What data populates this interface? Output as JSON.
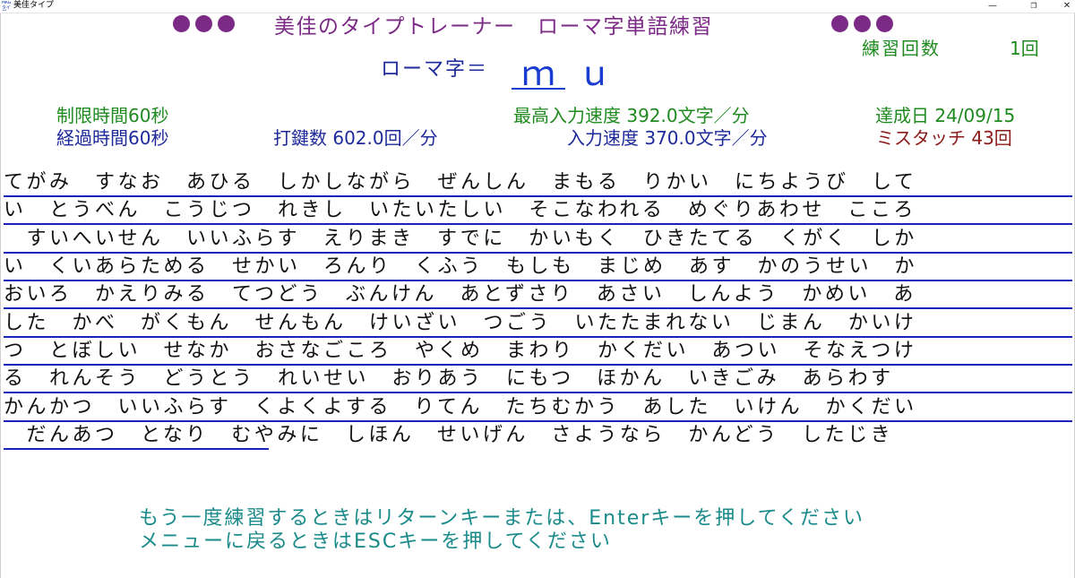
{
  "window": {
    "icon_text": "MKG タイプ",
    "title": "美佳タイプ",
    "min": "—",
    "max": "❐",
    "close": "✕"
  },
  "header": {
    "title": "美佳のタイプトレーナー　ローマ字単語練習"
  },
  "practice_count": {
    "label": "練習回数",
    "value": "1回"
  },
  "romaji": {
    "label": "ローマ字＝",
    "typed": "ｍ",
    "rest": "ｕ"
  },
  "stats": {
    "time_limit": "制限時間60秒",
    "elapsed": "経過時間60秒",
    "keystrokes": "打鍵数 602.0回／分",
    "best_speed": "最高入力速度 392.0文字／分",
    "achieved_date": "達成日 24/09/15",
    "input_speed": "入力速度 370.0文字／分",
    "mistouch": "ミスタッチ 43回"
  },
  "text_lines": [
    "てがみ　すなお　あひる　しかしながら　ぜんしん　まもる　りかい　にちようび　して",
    "い　とうべん　こうじつ　れきし　いたいたしい　そこなわれる　めぐりあわせ　こころ",
    "　すいへいせん　いいふらす　えりまき　すでに　かいもく　ひきたてる　くがく　しか",
    "い　くいあらためる　せかい　ろんり　くふう　もしも　まじめ　あす　かのうせい　か",
    "おいろ　かえりみる　てつどう　ぶんけん　あとずさり　あさい　しんよう　かめい　あ",
    "した　かべ　がくもん　せんもん　けいざい　つごう　いたたまれない　じまん　かいけ",
    "つ　とぼしい　せなか　おさなごころ　やくめ　まわり　かくだい　あつい　そなえつけ",
    "る　れんそう　どうとう　れいせい　おりあう　にもつ　ほかん　いきごみ　あらわす",
    "かんかつ　いいふらす　くよくよする　りてん　たちむかう　あした　いけん　かくだい",
    "　だんあつ　となり　むやみに　しほん　せいげん　さようなら　かんどう　したじき"
  ],
  "messages": {
    "retry": "もう一度練習するときはリターンキーまたは、Enterキーを押してください",
    "menu": "メニューに戻るときはESCキーを押してください"
  },
  "colors": {
    "dots": "#7b2a86",
    "rule": "#1a23b8",
    "green": "#1f8a1f",
    "navy": "#1e2a9a",
    "red": "#8b1a1a",
    "teal": "#1a8a8a"
  }
}
